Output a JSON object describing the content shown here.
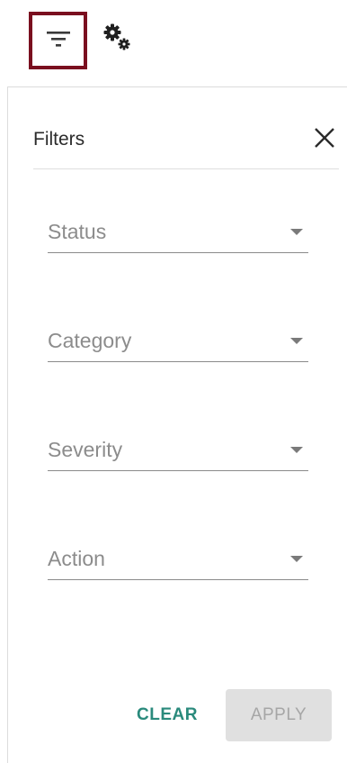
{
  "toolbar": {
    "filter_icon": "filter-icon",
    "settings_icon": "gear-icon",
    "highlight_color": "#7a0f1f"
  },
  "filters_panel": {
    "title": "Filters",
    "close_icon": "close-icon",
    "fields": [
      {
        "label": "Status"
      },
      {
        "label": "Category"
      },
      {
        "label": "Severity"
      },
      {
        "label": "Action"
      }
    ],
    "clear_label": "CLEAR",
    "apply_label": "APPLY",
    "apply_enabled": false,
    "accent_color": "#2a8a7c"
  }
}
